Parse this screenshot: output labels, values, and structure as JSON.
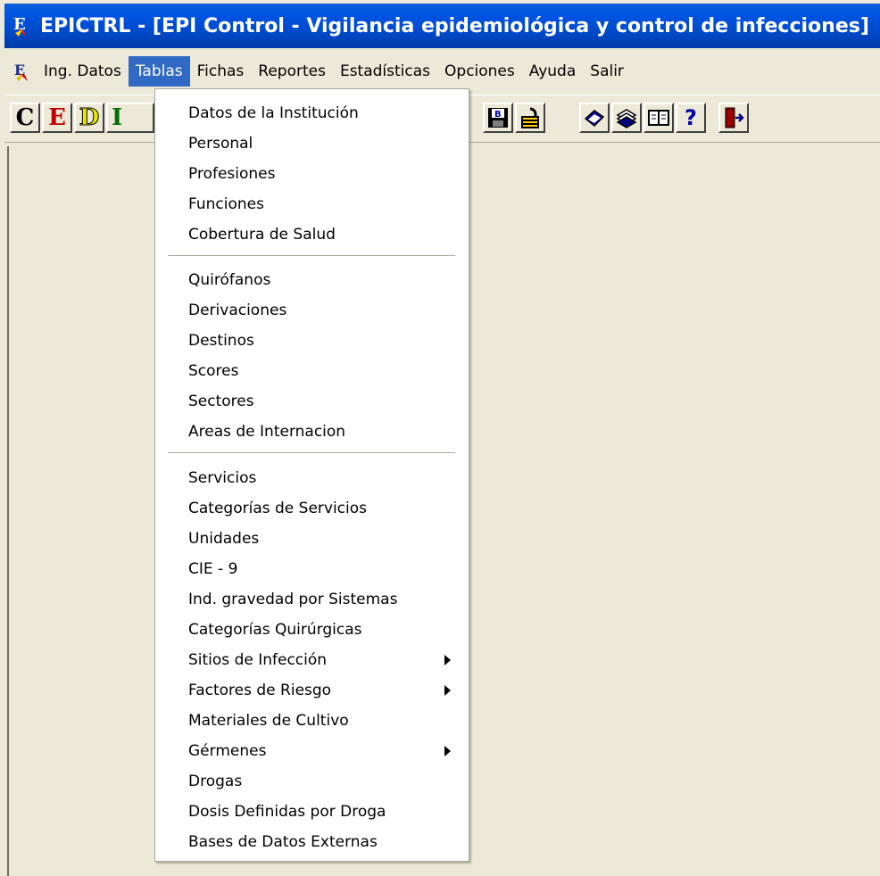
{
  "window": {
    "title": "EPICTRL - [EPI Control - Vigilancia epidemiológica y control de infecciones]"
  },
  "menubar": {
    "items": [
      {
        "label": "Ing. Datos"
      },
      {
        "label": "Tablas",
        "active": true
      },
      {
        "label": "Fichas"
      },
      {
        "label": "Reportes"
      },
      {
        "label": "Estadísticas"
      },
      {
        "label": "Opciones"
      },
      {
        "label": "Ayuda"
      },
      {
        "label": "Salir"
      }
    ]
  },
  "toolbar": {
    "letters": [
      "C",
      "E",
      "D",
      "I"
    ],
    "help_label": "?"
  },
  "tablas_menu": {
    "group1": [
      "Datos de la Institución",
      "Personal",
      "Profesiones",
      "Funciones",
      "Cobertura de Salud"
    ],
    "group2": [
      "Quirófanos",
      "Derivaciones",
      "Destinos",
      "Scores",
      "Sectores",
      "Areas de Internacion"
    ],
    "group3": [
      "Servicios",
      "Categorías de Servicios",
      "Unidades",
      "CIE - 9",
      "Ind. gravedad por Sistemas",
      "Categorías Quirúrgicas",
      "Sitios de Infección",
      "Factores de Riesgo",
      "Materiales de Cultivo",
      "Gérmenes",
      "Drogas",
      "Dosis Definidas por Droga",
      "Bases de Datos Externas"
    ]
  },
  "colors": {
    "titlebar": "#0054e3",
    "menu_highlight": "#316ac5",
    "face": "#ece9d8"
  }
}
